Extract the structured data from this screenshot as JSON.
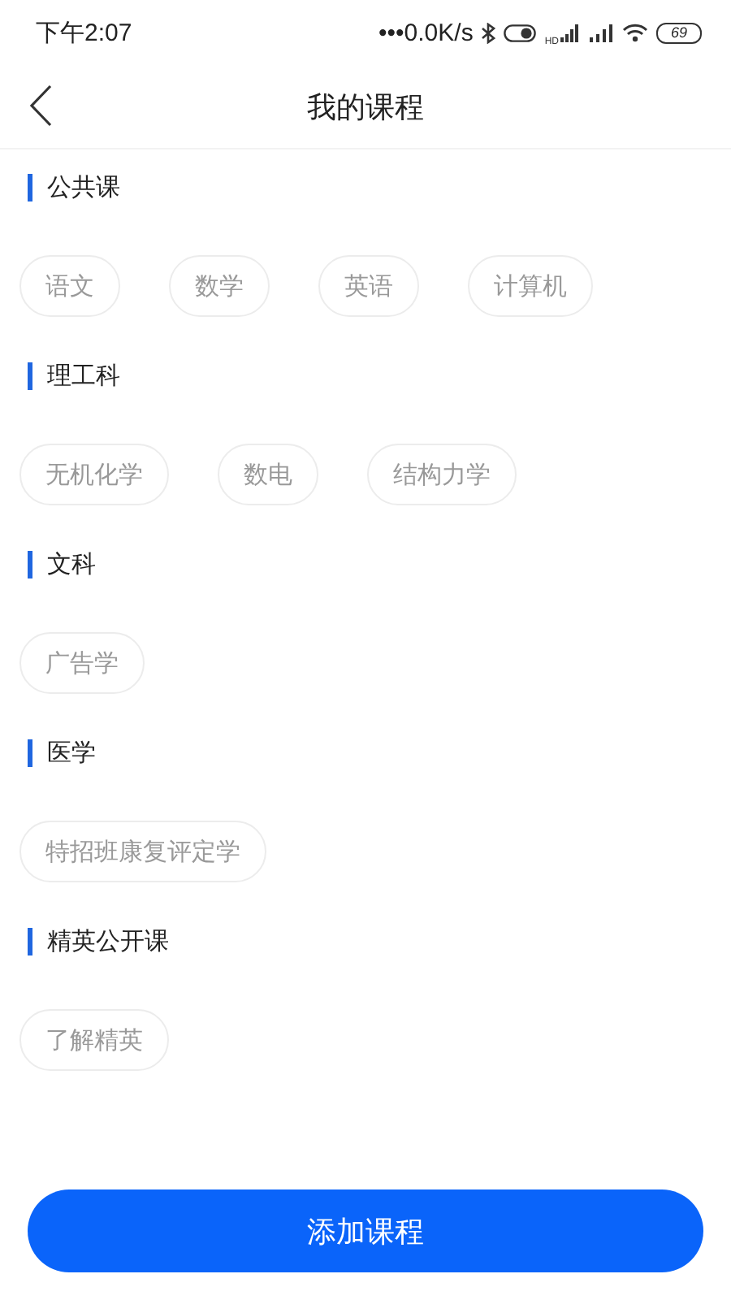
{
  "status_bar": {
    "time": "下午2:07",
    "speed": "•••0.0K/s",
    "hd": "HD",
    "battery": "69"
  },
  "header": {
    "title": "我的课程"
  },
  "sections": [
    {
      "title": "公共课",
      "courses": [
        "语文",
        "数学",
        "英语",
        "计算机"
      ]
    },
    {
      "title": "理工科",
      "courses": [
        "无机化学",
        "数电",
        "结构力学"
      ]
    },
    {
      "title": "文科",
      "courses": [
        "广告学"
      ]
    },
    {
      "title": "医学",
      "courses": [
        "特招班康复评定学"
      ]
    },
    {
      "title": "精英公开课",
      "courses": [
        "了解精英"
      ]
    }
  ],
  "add_button": "添加课程"
}
